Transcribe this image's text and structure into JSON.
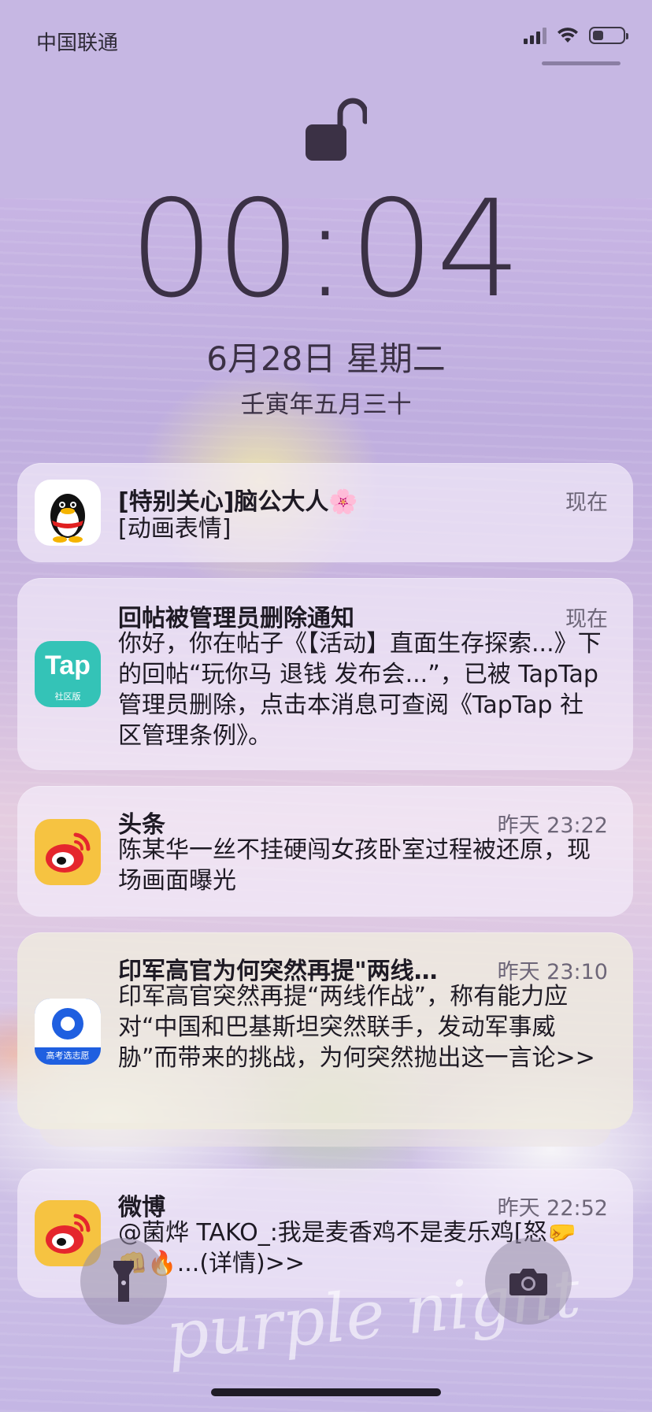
{
  "status_bar": {
    "carrier": "中国联通",
    "signal_bars": 4,
    "wifi": "wifi-icon",
    "battery_level": 0.35
  },
  "lock_screen": {
    "time": "00:04",
    "date": "6月28日 星期二",
    "lunar_date": "壬寅年五月三十"
  },
  "notifications": [
    {
      "app": "QQ",
      "icon": "qq-penguin-icon",
      "title": "[特别关心]脑公大人🌸",
      "time": "现在",
      "body": "[动画表情]"
    },
    {
      "app": "TapTap",
      "icon": "taptap-icon",
      "icon_text": "Tap",
      "icon_subtext": "社区版",
      "title": "回帖被管理员删除通知",
      "time": "现在",
      "body": "你好，你在帖子《【活动】直面生存探索...》下的回帖“玩你马 退钱 发布会...”，已被 TapTap 管理员删除，点击本消息可查阅《TapTap 社区管理条例》。"
    },
    {
      "app": "微博",
      "icon": "weibo-icon",
      "title": "头条",
      "time": "昨天 23:22",
      "body": "陈某华一丝不挂硬闯女孩卧室过程被还原，现场画面曝光"
    },
    {
      "app": "高考选志愿",
      "icon": "gaokao-app-icon",
      "icon_subtext": "高考选志愿",
      "title": "印军高官为何突然再提\"两线…",
      "time": "昨天 23:10",
      "body": "印军高官突然再提“两线作战”，称有能力应对“中国和巴基斯坦突然联手，发动军事威胁”而带来的挑战，为何突然抛出这一言论>>"
    },
    {
      "app": "微博",
      "icon": "weibo-icon",
      "title": "微博",
      "time": "昨天 22:52",
      "body": "@菌烨 TAKO_:我是麦香鸡不是麦乐鸡[怒🤛👊🔥...(详情)>>"
    }
  ],
  "controls": {
    "flashlight": "flashlight-icon",
    "camera": "camera-icon"
  },
  "wallpaper": {
    "text": "purple night"
  },
  "colors": {
    "card_bg": "#f5eefa",
    "text": "#1e1a24",
    "secondary": "#6d6678",
    "tap_teal": "#34c3b7",
    "weibo_red": "#e5262d",
    "weibo_yellow": "#f6c341"
  }
}
